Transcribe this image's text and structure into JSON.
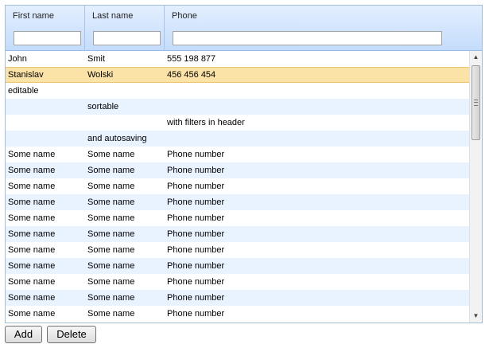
{
  "grid": {
    "columns": [
      {
        "label": "First name",
        "filter": ""
      },
      {
        "label": "Last name",
        "filter": ""
      },
      {
        "label": "Phone",
        "filter": ""
      }
    ],
    "rows": [
      [
        "John",
        "Smit",
        "555 198 877"
      ],
      [
        "Stanislav",
        "Wolski",
        "456 456 454"
      ],
      [
        "editable",
        "",
        ""
      ],
      [
        "",
        "sortable",
        ""
      ],
      [
        "",
        "",
        "with filters in header"
      ],
      [
        "",
        "and autosaving",
        ""
      ],
      [
        "Some name",
        "Some name",
        "Phone number"
      ],
      [
        "Some name",
        "Some name",
        "Phone number"
      ],
      [
        "Some name",
        "Some name",
        "Phone number"
      ],
      [
        "Some name",
        "Some name",
        "Phone number"
      ],
      [
        "Some name",
        "Some name",
        "Phone number"
      ],
      [
        "Some name",
        "Some name",
        "Phone number"
      ],
      [
        "Some name",
        "Some name",
        "Phone number"
      ],
      [
        "Some name",
        "Some name",
        "Phone number"
      ],
      [
        "Some name",
        "Some name",
        "Phone number"
      ],
      [
        "Some name",
        "Some name",
        "Phone number"
      ],
      [
        "Some name",
        "Some name",
        "Phone number"
      ]
    ],
    "selected_row": 1
  },
  "buttons": {
    "add_label": "Add",
    "delete_label": "Delete"
  },
  "colors": {
    "header_bg": "#c4dcfb",
    "alt_row_bg": "#e9f2ff",
    "selected_row_bg": "#fbe2a6"
  },
  "icons": {
    "scroll_up": "triangle-up",
    "scroll_down": "triangle-down"
  }
}
